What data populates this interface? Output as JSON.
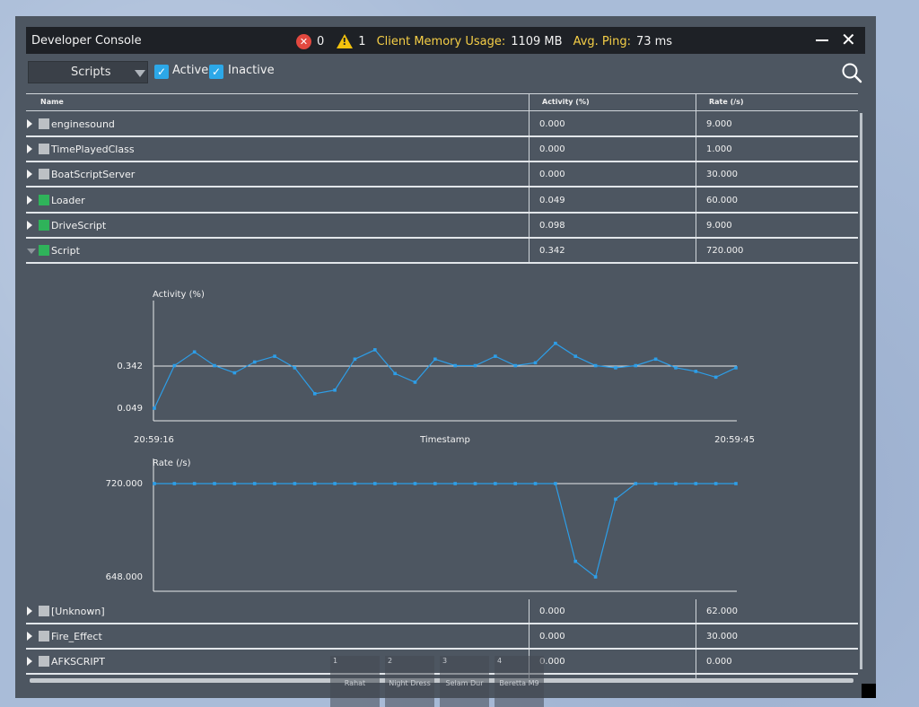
{
  "window": {
    "title": "Developer Console",
    "error_count": "0",
    "warning_count": "1",
    "memory_label": "Client Memory Usage:",
    "memory_value": "1109 MB",
    "ping_label": "Avg. Ping:",
    "ping_value": "73 ms"
  },
  "toolbar": {
    "dropdown_value": "Scripts",
    "filters": [
      {
        "label": "Active",
        "checked": true
      },
      {
        "label": "Inactive",
        "checked": true
      }
    ]
  },
  "table": {
    "columns": [
      "Name",
      "Activity (%)",
      "Rate (/s)"
    ],
    "rows_top": [
      {
        "name": "enginesound",
        "activity": "0.000",
        "rate": "9.000",
        "active": false,
        "expanded": false
      },
      {
        "name": "TimePlayedClass",
        "activity": "0.000",
        "rate": "1.000",
        "active": false,
        "expanded": false
      },
      {
        "name": "BoatScriptServer",
        "activity": "0.000",
        "rate": "30.000",
        "active": false,
        "expanded": false
      },
      {
        "name": "Loader",
        "activity": "0.049",
        "rate": "60.000",
        "active": true,
        "expanded": false
      },
      {
        "name": "DriveScript",
        "activity": "0.098",
        "rate": "9.000",
        "active": true,
        "expanded": false
      },
      {
        "name": "Script",
        "activity": "0.342",
        "rate": "720.000",
        "active": true,
        "expanded": true
      }
    ],
    "rows_bottom": [
      {
        "name": "[Unknown]",
        "activity": "0.000",
        "rate": "62.000",
        "active": false,
        "expanded": false
      },
      {
        "name": "Fire_Effect",
        "activity": "0.000",
        "rate": "30.000",
        "active": false,
        "expanded": false
      },
      {
        "name": "AFKSCRIPT",
        "activity": "0.000",
        "rate": "0.000",
        "active": false,
        "expanded": false
      }
    ]
  },
  "chart_data": [
    {
      "type": "line",
      "title": "Activity (%)",
      "xlabel": "Timestamp",
      "x_start": "20:59:16",
      "x_end": "20:59:45",
      "y_ticks": [
        0.342,
        0.049
      ],
      "ylim": [
        0.049,
        0.342
      ],
      "line_color": "#2d9ee8",
      "values": [
        0.049,
        0.345,
        0.44,
        0.345,
        0.295,
        0.37,
        0.41,
        0.33,
        0.15,
        0.175,
        0.39,
        0.455,
        0.29,
        0.23,
        0.39,
        0.345,
        0.345,
        0.41,
        0.345,
        0.365,
        0.5,
        0.41,
        0.345,
        0.33,
        0.345,
        0.39,
        0.33,
        0.305,
        0.265,
        0.33
      ]
    },
    {
      "type": "line",
      "title": "Rate (/s)",
      "xlabel": "Timestamp",
      "x_start": "20:59:16",
      "x_end": "20:59:45",
      "y_ticks": [
        720.0,
        648.0
      ],
      "ylim": [
        648.0,
        720.0
      ],
      "line_color": "#2d9ee8",
      "values": [
        720,
        720,
        720,
        720,
        720,
        720,
        720,
        720,
        720,
        720,
        720,
        720,
        720,
        720,
        720,
        720,
        720,
        720,
        720,
        720,
        720,
        660,
        648,
        708,
        720,
        720,
        720,
        720,
        720,
        720
      ]
    }
  ],
  "hotbar": [
    {
      "slot": "1",
      "label": "Rahat"
    },
    {
      "slot": "2",
      "label": "Night Dress"
    },
    {
      "slot": "3",
      "label": "Selam Dur"
    },
    {
      "slot": "4",
      "label": "Beretta M9"
    }
  ]
}
